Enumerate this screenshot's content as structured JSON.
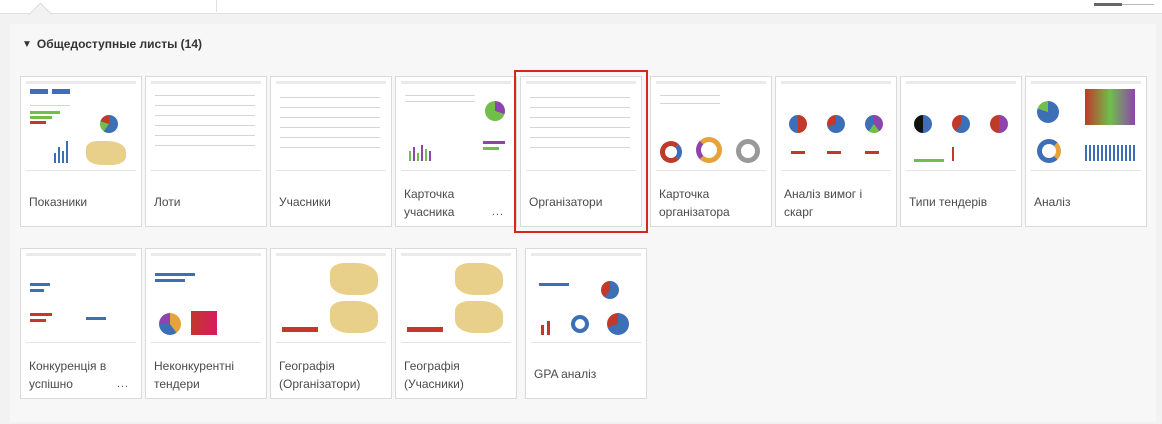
{
  "section": {
    "title": "Общедоступные листы (14)",
    "toggle_glyph": "▼"
  },
  "accent_colors": {
    "selection_outline": "#d9261c",
    "chart_blue": "#3d6fb6",
    "chart_red": "#c0392b",
    "chart_green": "#6fbf4a",
    "chart_purple": "#8e44ad"
  },
  "sheets": [
    {
      "title": "Показники",
      "selected": false,
      "has_more": false
    },
    {
      "title": "Лоти",
      "selected": false,
      "has_more": false
    },
    {
      "title": "Учасники",
      "selected": false,
      "has_more": false
    },
    {
      "title": "Карточка учасника",
      "selected": false,
      "has_more": true
    },
    {
      "title": "Організатори",
      "selected": true,
      "has_more": false
    },
    {
      "title": "Карточка організатора",
      "selected": false,
      "has_more": false
    },
    {
      "title": "Аналіз вимог і скарг",
      "selected": false,
      "has_more": false
    },
    {
      "title": "Типи тендерів",
      "selected": false,
      "has_more": false
    },
    {
      "title": "Аналіз",
      "selected": false,
      "has_more": false
    },
    {
      "title": "Конкуренція в успішно",
      "selected": false,
      "has_more": true
    },
    {
      "title": "Неконкурентні тендери",
      "selected": false,
      "has_more": false
    },
    {
      "title": "Географія (Організатори)",
      "selected": false,
      "has_more": false
    },
    {
      "title": "Географія (Учасники)",
      "selected": false,
      "has_more": false
    },
    {
      "title": "GPA аналіз",
      "selected": false,
      "has_more": false
    }
  ],
  "more_glyph": "..."
}
